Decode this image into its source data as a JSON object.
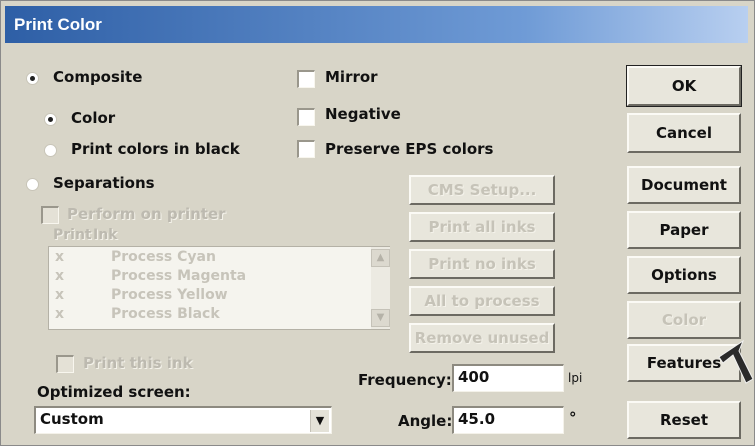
{
  "window": {
    "title": "Print Color"
  },
  "options": {
    "composite": "Composite",
    "color": "Color",
    "print_black": "Print colors in black",
    "separations": "Separations",
    "perform_on_printer": "Perform on printer",
    "mirror": "Mirror",
    "negative": "Negative",
    "preserve_eps": "Preserve EPS colors"
  },
  "inks": {
    "header_print": "Print",
    "header_ink": "Ink",
    "rows": [
      {
        "print": "x",
        "ink": "Process Cyan"
      },
      {
        "print": "x",
        "ink": "Process Magenta"
      },
      {
        "print": "x",
        "ink": "Process Yellow"
      },
      {
        "print": "x",
        "ink": "Process Black"
      }
    ],
    "print_this_ink": "Print this ink"
  },
  "ink_buttons": {
    "cms_setup": "CMS Setup...",
    "print_all": "Print all inks",
    "print_no": "Print no inks",
    "all_process": "All to process",
    "remove_unused": "Remove unused"
  },
  "screen": {
    "label": "Optimized screen:",
    "value": "Custom",
    "frequency_label": "Frequency:",
    "frequency_value": "400",
    "frequency_unit": "lpi",
    "angle_label": "Angle:",
    "angle_value": "45.0",
    "angle_unit": "°"
  },
  "side_buttons": {
    "ok": "OK",
    "cancel": "Cancel",
    "document": "Document",
    "paper": "Paper",
    "options": "Options",
    "color": "Color",
    "features": "Features",
    "reset": "Reset"
  },
  "colors": {
    "title_bar": "#2e5fa6",
    "dialog_bg": "#d8d5c8"
  }
}
